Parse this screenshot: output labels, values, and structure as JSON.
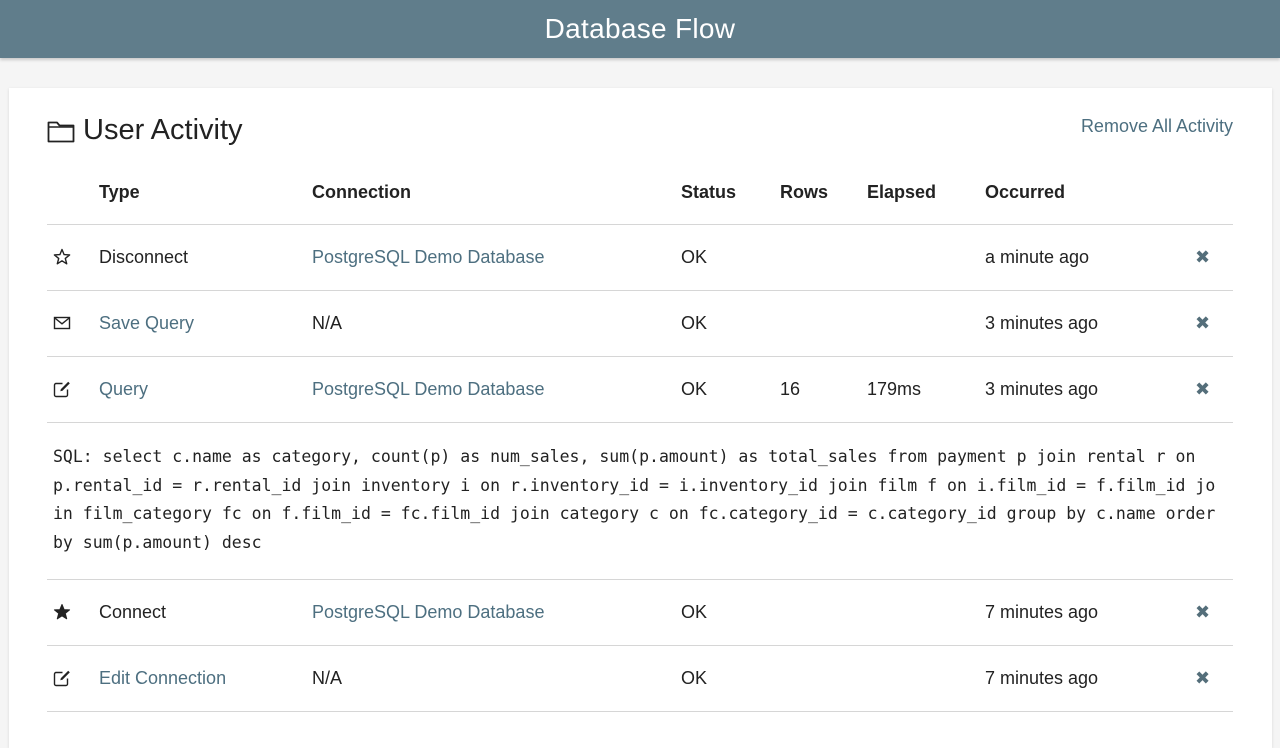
{
  "app": {
    "title": "Database Flow"
  },
  "card": {
    "title": "User Activity",
    "remove_all_label": "Remove All Activity"
  },
  "table": {
    "headers": {
      "type": "Type",
      "connection": "Connection",
      "status": "Status",
      "rows": "Rows",
      "elapsed": "Elapsed",
      "occurred": "Occurred"
    },
    "rows": [
      {
        "icon": "star-outline-icon",
        "type": "Disconnect",
        "type_link": false,
        "connection": "PostgreSQL Demo Database",
        "connection_link": true,
        "status": "OK",
        "rows": "",
        "elapsed": "",
        "occurred": "a minute ago",
        "remove": "✖"
      },
      {
        "icon": "envelope-icon",
        "type": "Save Query",
        "type_link": true,
        "connection": "N/A",
        "connection_link": false,
        "status": "OK",
        "rows": "",
        "elapsed": "",
        "occurred": "3 minutes ago",
        "remove": "✖"
      },
      {
        "icon": "edit-icon",
        "type": "Query",
        "type_link": true,
        "connection": "PostgreSQL Demo Database",
        "connection_link": true,
        "status": "OK",
        "rows": "16",
        "elapsed": "179ms",
        "occurred": "3 minutes ago",
        "remove": "✖"
      },
      {
        "icon": "star-filled-icon",
        "type": "Connect",
        "type_link": false,
        "connection": "PostgreSQL Demo Database",
        "connection_link": true,
        "status": "OK",
        "rows": "",
        "elapsed": "",
        "occurred": "7 minutes ago",
        "remove": "✖"
      },
      {
        "icon": "edit-icon",
        "type": "Edit Connection",
        "type_link": true,
        "connection": "N/A",
        "connection_link": false,
        "status": "OK",
        "rows": "",
        "elapsed": "",
        "occurred": "7 minutes ago",
        "remove": "✖"
      }
    ],
    "sql_detail": "SQL: select c.name as category, count(p) as num_sales, sum(p.amount) as total_sales from payment p join rental r on p.rental_id = r.rental_id join inventory i on r.inventory_id = i.inventory_id join film f on i.film_id = f.film_id join film_category fc on f.film_id = fc.film_id join category c on fc.category_id = c.category_id group by c.name order by sum(p.amount) desc"
  },
  "colors": {
    "topbar": "#607d8b",
    "link": "#4d6f80",
    "page_bg": "#f5f5f5"
  }
}
